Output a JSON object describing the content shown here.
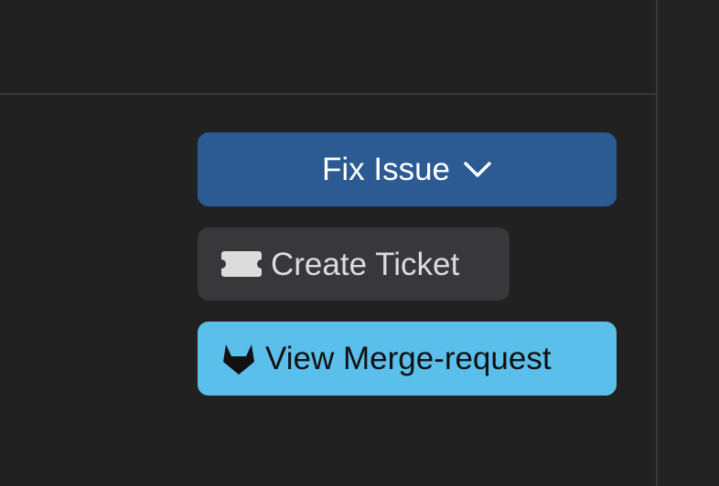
{
  "colors": {
    "background": "#212121",
    "divider": "#3a3a3a",
    "fix_button_bg": "#2c5a92",
    "ticket_button_bg": "#38383b",
    "merge_button_bg": "#5bbfec"
  },
  "actions": {
    "fix_issue": {
      "label": "Fix Issue",
      "icon": "chevron-down-icon"
    },
    "create_ticket": {
      "label": "Create Ticket",
      "icon": "ticket-icon"
    },
    "view_merge_request": {
      "label": "View Merge-request",
      "icon": "gitlab-icon"
    }
  }
}
